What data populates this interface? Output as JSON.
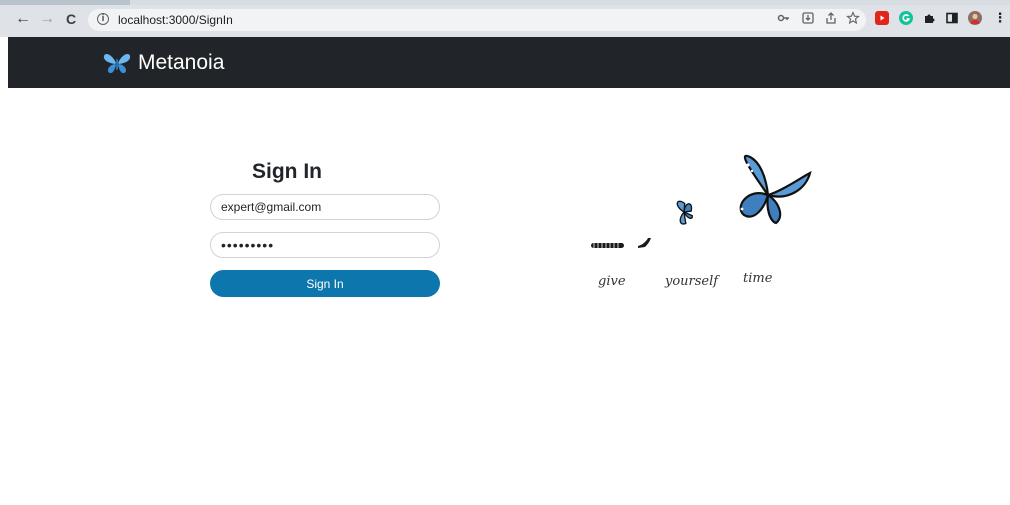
{
  "browser": {
    "url": "localhost:3000/SignIn",
    "nav": {
      "back_icon": "←",
      "forward_icon": "→",
      "reload_icon": "C"
    },
    "info_icon": "i"
  },
  "app": {
    "brand": "Metanoia"
  },
  "signin": {
    "title": "Sign In",
    "email_value": "expert@gmail.com",
    "password_value": "•••••••••",
    "submit_label": "Sign In"
  },
  "illustration": {
    "words": [
      "give",
      "yourself",
      "time"
    ]
  },
  "colors": {
    "navbar": "#212529",
    "button": "#0d77ad",
    "butterfly": "#5b9bd5"
  }
}
